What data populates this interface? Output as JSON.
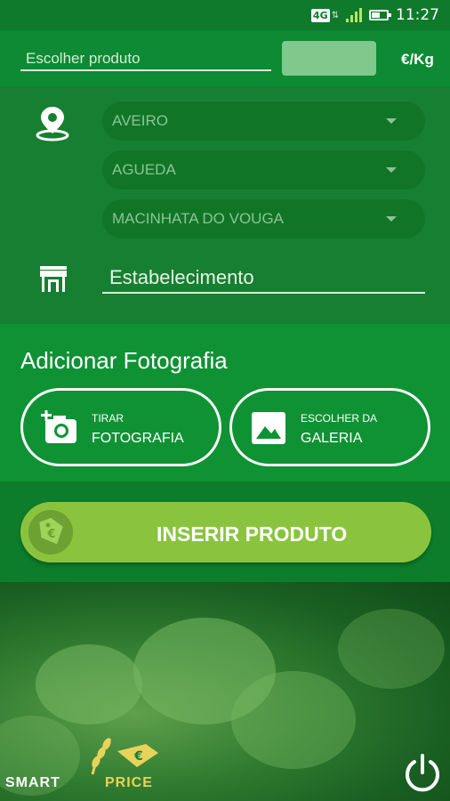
{
  "status_bar": {
    "network": "4G",
    "time": "11:27",
    "battery_level": 0.55
  },
  "product": {
    "placeholder": "Escolher produto",
    "unit": "€/Kg"
  },
  "location": {
    "district": "AVEIRO",
    "municipality": "AGUEDA",
    "parish": "MACINHATA DO VOUGA"
  },
  "store": {
    "placeholder": "Estabelecimento"
  },
  "photo": {
    "title": "Adicionar Fotografia",
    "take_small": "TIRAR",
    "take_big": "FOTOGRAFIA",
    "gallery_small": "ESCOLHER DA",
    "gallery_big": "GALERIA"
  },
  "insert": {
    "label": "INSERIR PRODUTO"
  },
  "logo": {
    "smart": "SMART",
    "price": "PRICE"
  },
  "icons": {
    "location": "location-pin-icon",
    "store": "store-icon",
    "camera": "add-camera-icon",
    "gallery": "gallery-image-icon",
    "tag": "euro-tag-icon",
    "power": "power-icon"
  },
  "colors": {
    "accent": "#8ac43f",
    "header": "#0d8a33",
    "status_bar": "#0f7a2b"
  }
}
